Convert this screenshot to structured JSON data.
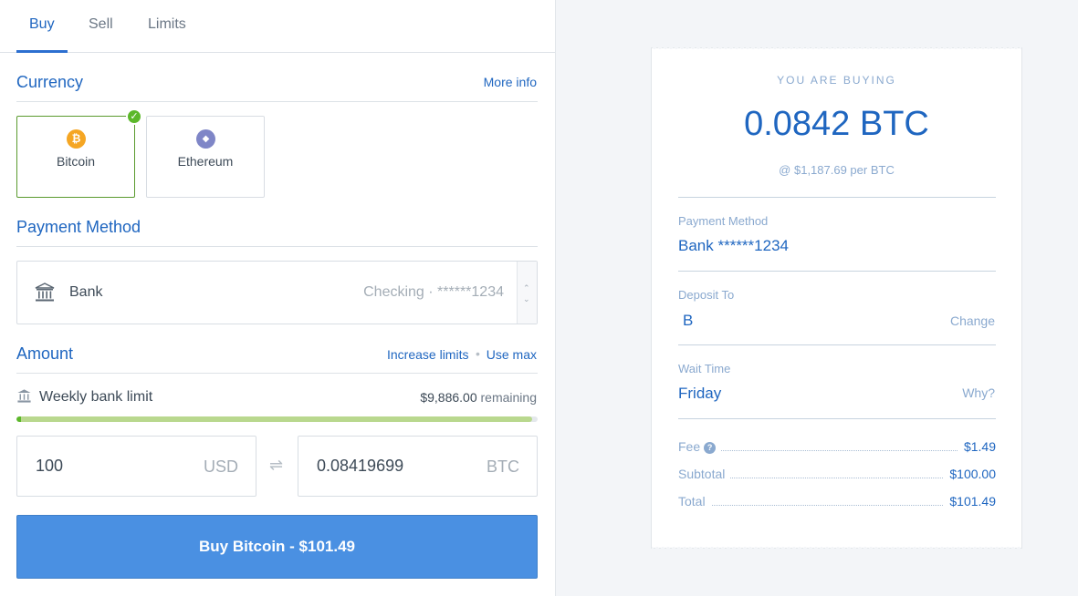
{
  "tabs": [
    {
      "label": "Buy",
      "active": true
    },
    {
      "label": "Sell",
      "active": false
    },
    {
      "label": "Limits",
      "active": false
    }
  ],
  "currency": {
    "title": "Currency",
    "more_info": "More info",
    "options": [
      {
        "name": "Bitcoin",
        "symbol": "₿",
        "color": "#f5a623",
        "selected": true,
        "icon": "bitcoin-icon"
      },
      {
        "name": "Ethereum",
        "symbol": "◆",
        "color": "#7f86c7",
        "selected": false,
        "icon": "ethereum-icon"
      }
    ]
  },
  "payment": {
    "title": "Payment Method",
    "method": "Bank",
    "detail": "Checking · ******1234",
    "icon": "bank-icon"
  },
  "amount": {
    "title": "Amount",
    "increase_limits": "Increase limits",
    "use_max": "Use max",
    "limit_label": "Weekly bank limit",
    "limit_remaining_value": "$9,886.00",
    "limit_remaining_suffix": "remaining",
    "limit_used_fraction": 0.99,
    "fiat_value": "100",
    "fiat_unit": "USD",
    "crypto_value": "0.08419699",
    "crypto_unit": "BTC",
    "swap_icon": "swap-arrows-icon"
  },
  "buy_button": "Buy Bitcoin - $101.49",
  "receipt": {
    "heading": "YOU ARE BUYING",
    "amount": "0.0842 BTC",
    "rate": "@ $1,187.69 per BTC",
    "payment_label": "Payment Method",
    "payment_value": "Bank ******1234",
    "deposit_label": "Deposit To",
    "deposit_value": "B",
    "deposit_link": "Change",
    "wait_label": "Wait Time",
    "wait_value": "Friday",
    "wait_link": "Why?",
    "fee_label": "Fee",
    "fee_value": "$1.49",
    "subtotal_label": "Subtotal",
    "subtotal_value": "$100.00",
    "total_label": "Total",
    "total_value": "$101.49"
  },
  "colors": {
    "accent": "#1f66c0",
    "button": "#4a90e2",
    "success": "#5cb82a"
  }
}
